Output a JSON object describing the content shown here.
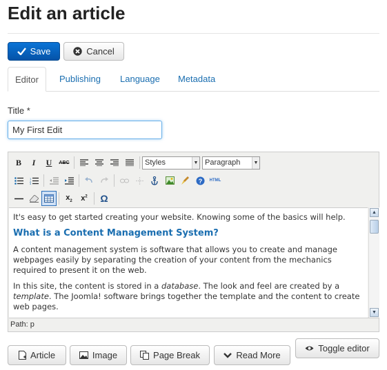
{
  "page": {
    "title": "Edit an article"
  },
  "actions": {
    "save_label": "Save",
    "cancel_label": "Cancel"
  },
  "tabs": [
    {
      "label": "Editor",
      "active": true
    },
    {
      "label": "Publishing",
      "active": false
    },
    {
      "label": "Language",
      "active": false
    },
    {
      "label": "Metadata",
      "active": false
    }
  ],
  "form": {
    "title_label": "Title *",
    "title_value": "My First Edit"
  },
  "editor": {
    "styles_select": "Styles",
    "format_select": "Paragraph",
    "toolbar_row1": [
      "bold-icon",
      "italic-icon",
      "underline-icon",
      "strikethrough-icon",
      "align-left-icon",
      "align-center-icon",
      "align-right-icon",
      "align-justify-icon"
    ],
    "toolbar_row2": [
      "bullet-list-icon",
      "numbered-list-icon",
      "outdent-icon",
      "indent-icon",
      "undo-icon",
      "redo-icon",
      "link-icon",
      "unlink-icon",
      "anchor-icon",
      "image-icon",
      "cleanup-icon",
      "help-icon",
      "html-icon"
    ],
    "toolbar_row3": [
      "horizontal-rule-icon",
      "eraser-icon",
      "table-icon",
      "subscript-icon",
      "superscript-icon",
      "special-char-icon"
    ],
    "html_label": "HTML",
    "content": {
      "p1": "It's easy to get started creating your website. Knowing some of the basics will help.",
      "h1": "What is a Content Management System?",
      "p2": "A content management system is software that allows you to create and manage webpages easily by separating the creation of your content from the mechanics required to present it on the web.",
      "p3a": "In this site, the content is stored in a ",
      "p3b": "database",
      "p3c": ". The look and feel are created by a ",
      "p3d": "template",
      "p3e": ". The Joomla! software brings together the template and the content to create web pages."
    },
    "path_label": "Path: p"
  },
  "bottom_buttons": {
    "article": "Article",
    "image": "Image",
    "page_break": "Page Break",
    "read_more": "Read More",
    "toggle_editor": "Toggle editor"
  },
  "colors": {
    "primary": "#0a66c2",
    "link": "#1a6eb0",
    "focus": "#66afe9"
  }
}
